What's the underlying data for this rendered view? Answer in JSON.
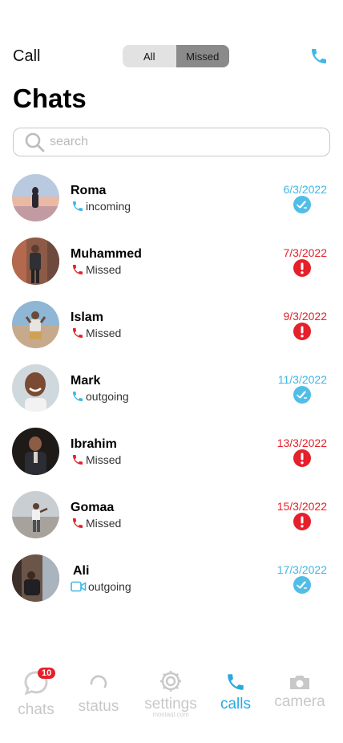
{
  "header": {
    "title": "Call",
    "tabs": [
      "All",
      "Missed"
    ],
    "active_tab": "Missed",
    "call_icon": "phone-icon"
  },
  "page_title": "Chats",
  "search": {
    "placeholder": "search"
  },
  "colors": {
    "accent": "#3fb7e4",
    "missed": "#e5202a"
  },
  "chats": [
    {
      "name": "Roma",
      "call_type": "incoming",
      "call_icon": "phone-icon",
      "date": "6/3/2022",
      "status": "read-check-icon"
    },
    {
      "name": "Muhammed",
      "call_type": "Missed",
      "call_icon": "phone-icon",
      "date": "7/3/2022",
      "status": "alert-icon"
    },
    {
      "name": "Islam",
      "call_type": "Missed",
      "call_icon": "phone-icon",
      "date": "9/3/2022",
      "status": "alert-icon"
    },
    {
      "name": "Mark",
      "call_type": "outgoing",
      "call_icon": "phone-icon",
      "date": "11/3/2022",
      "status": "read-check-icon"
    },
    {
      "name": "Ibrahim",
      "call_type": "Missed",
      "call_icon": "phone-icon",
      "date": "13/3/2022",
      "status": "alert-icon"
    },
    {
      "name": "Gomaa",
      "call_type": "Missed",
      "call_icon": "phone-icon",
      "date": "15/3/2022",
      "status": "alert-icon"
    },
    {
      "name": "Ali",
      "call_type": "outgoing",
      "call_icon": "video-icon",
      "date": "17/3/2022",
      "status": "read-check-icon"
    }
  ],
  "nav": {
    "chats": {
      "label": "chats",
      "badge": "10"
    },
    "status": {
      "label": "status"
    },
    "settings": {
      "label": "settings"
    },
    "calls": {
      "label": "calls"
    },
    "camera": {
      "label": "camera"
    }
  },
  "watermark": "mostaql.com"
}
